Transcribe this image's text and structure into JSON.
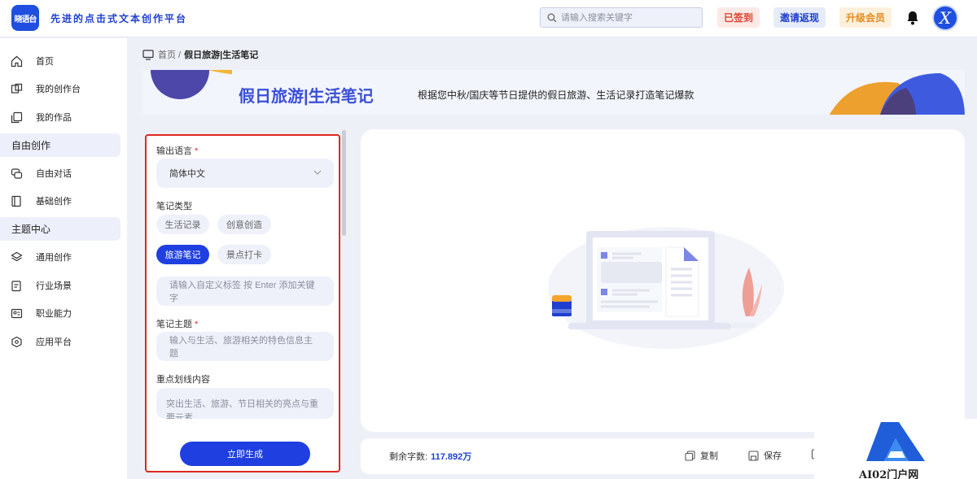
{
  "header": {
    "logo_text": "晓语台",
    "slogan": "先进的点击式文本创作平台",
    "search_placeholder": "请输入搜索关键字",
    "signed_label": "已签到",
    "invite_label": "邀请返现",
    "vip_label": "升级会员",
    "avatar_letter": "X"
  },
  "sidebar": {
    "items": [
      {
        "label": "首页",
        "icon": "home-icon"
      },
      {
        "label": "我的创作台",
        "icon": "grid-icon"
      },
      {
        "label": "我的作品",
        "icon": "copy-icon"
      }
    ],
    "section1": "自由创作",
    "items2": [
      {
        "label": "自由对话",
        "icon": "chat-icon"
      },
      {
        "label": "基础创作",
        "icon": "book-icon"
      }
    ],
    "section2": "主题中心",
    "items3": [
      {
        "label": "通用创作",
        "icon": "layers-icon"
      },
      {
        "label": "行业场景",
        "icon": "clipboard-icon"
      },
      {
        "label": "职业能力",
        "icon": "id-card-icon"
      },
      {
        "label": "应用平台",
        "icon": "cube-icon"
      }
    ]
  },
  "breadcrumb": {
    "home": "首页 /",
    "current": "假日旅游|生活笔记"
  },
  "banner": {
    "title": "假日旅游|生活笔记",
    "desc": "根据您中秋/国庆等节日提供的假日旅游、生活记录打造笔记爆款"
  },
  "form": {
    "lang_label": "输出语言",
    "lang_value": "简体中文",
    "type_label": "笔记类型",
    "chips": [
      "生活记录",
      "创意创造",
      "旅游笔记",
      "景点打卡"
    ],
    "active_chip": "旅游笔记",
    "tag_placeholder": "请输入自定义标签 按 Enter 添加关键字",
    "topic_label": "笔记主题",
    "topic_placeholder": "输入与生活、旅游相关的特色信息主题",
    "highlight_label": "重点划线内容",
    "highlight_placeholder": "突出生活、旅游、节日相关的亮点与重要元素",
    "generate_label": "立即生成"
  },
  "result": {
    "remain_label": "剩余字数:",
    "remain_value": "117.892万",
    "copy_label": "复制",
    "save_label": "保存"
  },
  "watermark": {
    "text": "AI02门户网"
  },
  "colors": {
    "primary": "#1f3fe0",
    "danger": "#e0271f",
    "warning": "#e58a1c"
  }
}
